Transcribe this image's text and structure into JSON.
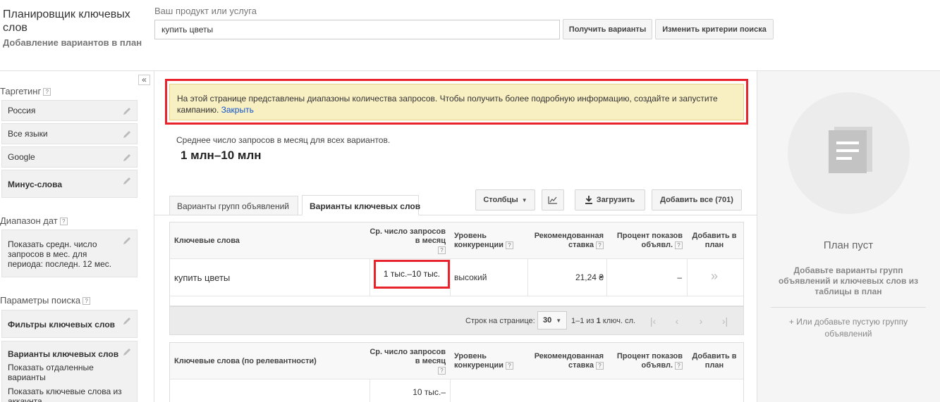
{
  "header": {
    "title": "Планировщик ключевых слов",
    "subtitle": "Добавление вариантов в план",
    "product_label": "Ваш продукт или услуга",
    "product_value": "купить цветы",
    "get_variants_btn": "Получить варианты",
    "change_criteria_btn": "Изменить критерии поиска"
  },
  "sidebar": {
    "collapse_icon": "«",
    "targeting_title": "Таргетинг",
    "targeting_items": [
      "Россия",
      "Все языки",
      "Google",
      "Минус-слова"
    ],
    "date_title": "Диапазон дат",
    "date_text": "Показать средн. число запросов в мес. для периода: последн. 12 мес.",
    "search_params_title": "Параметры поиска",
    "filters_label": "Фильтры ключевых слов",
    "variants_label": "Варианты ключевых слов",
    "variants_sub1": "Показать отдаленные варианты",
    "variants_sub2": "Показать ключевые слова из аккаунта"
  },
  "notice": {
    "text": "На этой странице представлены диапазоны количества запросов. Чтобы получить более подробную информацию, создайте и запустите кампанию.",
    "link": "Закрыть"
  },
  "summary": {
    "label": "Среднее число запросов в месяц для всех вариантов.",
    "value": "1 млн–10 млн"
  },
  "tabs": [
    "Варианты групп объявлений",
    "Варианты ключевых слов"
  ],
  "toolbar": {
    "columns_btn": "Столбцы",
    "download_btn": "Загрузить",
    "add_all_btn": "Добавить все (701)"
  },
  "table1": {
    "headers": [
      "Ключевые слова",
      "Ср. число запросов в месяц",
      "Уровень конкуренции",
      "Рекомендованная ставка",
      "Процент показов объявл.",
      "Добавить в план"
    ],
    "row": {
      "keyword": "купить цветы",
      "searches": "1 тыс.–10 тыс.",
      "competition": "высокий",
      "bid": "21,24 ₴",
      "impr_share": "–",
      "add": "»"
    }
  },
  "pagination": {
    "rows_label": "Строк на странице:",
    "rows_value": "30",
    "range_pre": "1–1 из",
    "range_count": "1",
    "range_post": "ключ. сл."
  },
  "table2": {
    "headers": [
      "Ключевые слова (по релевантности)",
      "Ср. число запросов в месяц",
      "Уровень конкуренции",
      "Рекомендованная ставка",
      "Процент показов объявл.",
      "Добавить в план"
    ],
    "partial_searches": "10 тыс.–"
  },
  "plan": {
    "empty_title": "План пуст",
    "hint": "Добавьте варианты групп объявлений и ключевых слов из таблицы в план",
    "add_empty_group": "+ Или добавьте пустую группу объявлений"
  },
  "colors": {
    "highlight": "#e8232c",
    "notice_bg": "#f8efc2",
    "link": "#1155cc"
  }
}
